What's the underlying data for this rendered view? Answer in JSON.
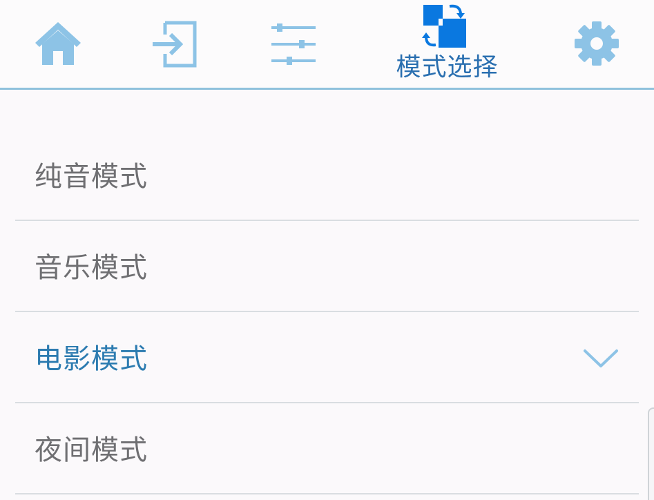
{
  "colors": {
    "tab_icon": "#8dc3e6",
    "active_icon": "#0a78e0",
    "active_label": "#2a6fb0",
    "item_text": "#6f6f72",
    "selected_text": "#2c7bb0",
    "header_divider": "#8ec1dc",
    "row_divider": "#d9dde1"
  },
  "tabs": [
    {
      "id": "home",
      "icon": "home-icon",
      "label": ""
    },
    {
      "id": "input",
      "icon": "input-source-icon",
      "label": ""
    },
    {
      "id": "equalizer",
      "icon": "equalizer-sliders-icon",
      "label": ""
    },
    {
      "id": "mode",
      "icon": "mode-switch-icon",
      "label": "模式选择",
      "active": true
    },
    {
      "id": "settings",
      "icon": "gear-icon",
      "label": ""
    }
  ],
  "modes": [
    {
      "label": "纯音模式",
      "selected": false
    },
    {
      "label": "音乐模式",
      "selected": false
    },
    {
      "label": "电影模式",
      "selected": true,
      "indicator": "chevron-down-icon"
    },
    {
      "label": "夜间模式",
      "selected": false
    }
  ]
}
